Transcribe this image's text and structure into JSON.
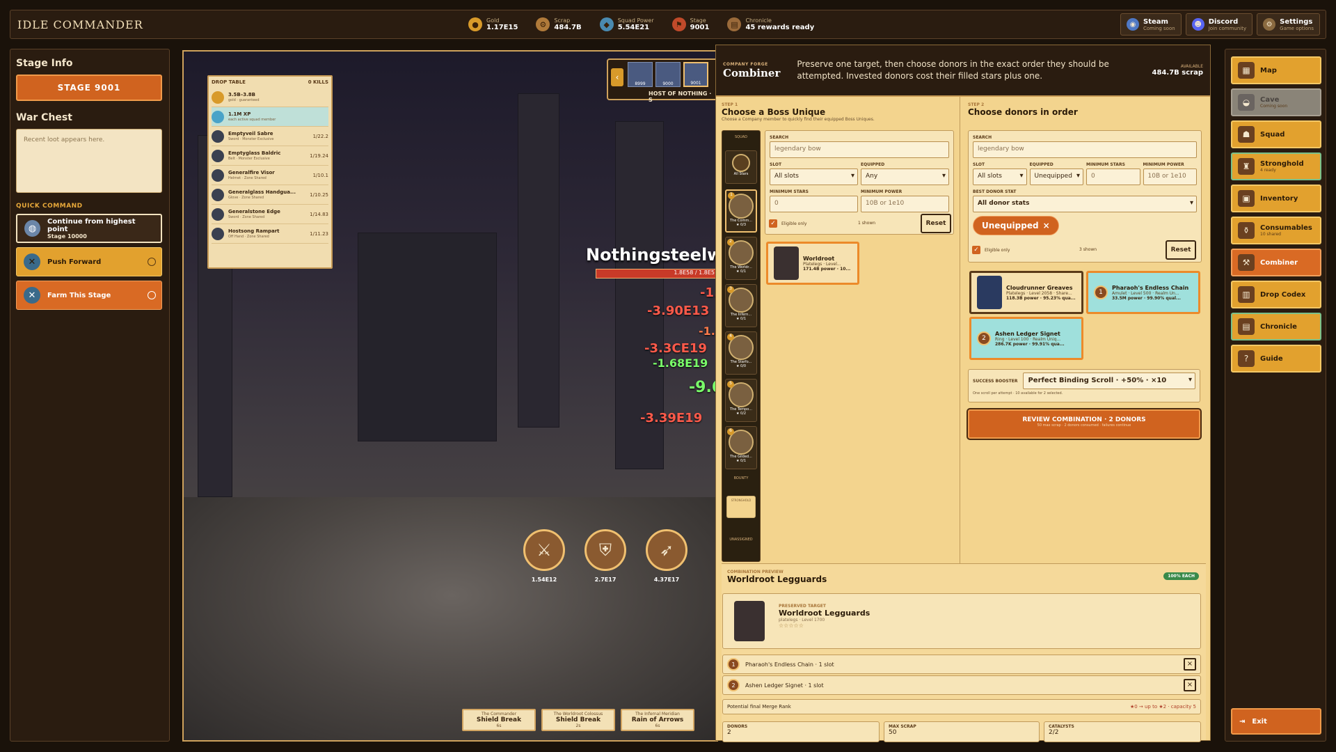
{
  "topbar": {
    "brand": "IDLE COMMANDER",
    "resources": [
      {
        "label": "Gold",
        "value": "1.17E15",
        "icon": "gold-coin-icon"
      },
      {
        "label": "Scrap",
        "value": "484.7B",
        "icon": "scrap-icon"
      },
      {
        "label": "Squad Power",
        "value": "5.54E21",
        "icon": "shield-icon"
      },
      {
        "label": "Stage",
        "value": "9001",
        "icon": "flag-icon"
      },
      {
        "label": "Chronicle",
        "value": "45 rewards ready",
        "icon": "book-icon"
      }
    ],
    "buttons": [
      {
        "title": "Steam",
        "sub": "Coming soon"
      },
      {
        "title": "Discord",
        "sub": "Join community"
      },
      {
        "title": "Settings",
        "sub": "Game options"
      }
    ]
  },
  "left": {
    "stage_info_title": "Stage Info",
    "stage_button": "STAGE 9001",
    "war_chest_title": "War Chest",
    "war_chest_placeholder": "Recent loot appears here.",
    "quick_command_title": "QUICK COMMAND",
    "continue_label": "Continue from highest point",
    "continue_sub": "Stage 10000",
    "push_label": "Push Forward",
    "farm_label": "Farm This Stage"
  },
  "drop_table": {
    "title": "DROP TABLE",
    "kills": "0 KILLS",
    "rows": [
      {
        "name": "3.5B–3.8B",
        "sub": "gold · guaranteed",
        "odds": ""
      },
      {
        "name": "1.1M XP",
        "sub": "each active squad member",
        "odds": ""
      },
      {
        "name": "Emptyveil Sabre",
        "sub": "Sword · Monster Exclusive",
        "odds": "1/22.2"
      },
      {
        "name": "Emptyglass Baldric",
        "sub": "Belt · Monster Exclusive",
        "odds": "1/19.24"
      },
      {
        "name": "Generalfire Visor",
        "sub": "Helmet · Zone Shared",
        "odds": "1/10.1"
      },
      {
        "name": "Generalglass Handgua...",
        "sub": "Glove · Zone Shared",
        "odds": "1/10.25"
      },
      {
        "name": "Generalstone Edge",
        "sub": "Sword · Zone Shared",
        "odds": "1/14.83"
      },
      {
        "name": "Hostsong Rampart",
        "sub": "Off Hand · Zone Shared",
        "odds": "1/11.23"
      }
    ]
  },
  "stage_picker": {
    "stages": [
      "8999",
      "9000",
      "9001"
    ],
    "label": "HOST OF NOTHING · S"
  },
  "battle": {
    "boss_name": "Nothingsteelw",
    "boss_hp": "1.8E58 / 1.8E5",
    "damage_numbers": [
      "-3.90E13",
      "-3.3CE19",
      "-1.68E19",
      "-9.6",
      "-3.39E19",
      "-1.5",
      "-1.1"
    ],
    "heroes": [
      "1.54E12",
      "2.7E17",
      "4.37E17"
    ],
    "skills": [
      {
        "owner": "The Commander",
        "name": "Shield Break",
        "count": "6s"
      },
      {
        "owner": "The Worldroot Colossus",
        "name": "Shield Break",
        "count": "2s"
      },
      {
        "owner": "The Infernal Meridian",
        "name": "Rain of Arrows",
        "count": "6s"
      }
    ]
  },
  "forge": {
    "tag": "COMPANY FORGE",
    "title": "Combiner",
    "desc": "Preserve one target, then choose donors in the exact order they should be attempted. Invested donors cost their filled stars plus one.",
    "available_label": "AVAILABLE",
    "available_value": "484.7B scrap",
    "step1": {
      "tag": "STEP 1",
      "title": "Choose a Boss Unique",
      "sub": "Choose a Company member to quickly find their equipped Boss Uniques.",
      "search_label": "SEARCH",
      "search_placeholder": "legendary bow",
      "slot_label": "SLOT",
      "slot_value": "All slots",
      "equipped_label": "EQUIPPED",
      "equipped_value": "Any",
      "min_stars_label": "MINIMUM STARS",
      "min_stars_placeholder": "0",
      "min_power_label": "MINIMUM POWER",
      "min_power_placeholder": "10B or 1e10",
      "eligible_label": "Eligible only",
      "shown": "1 shown",
      "reset": "Reset",
      "result": {
        "name": "Worldroot",
        "sub": "Platelegs · Level...",
        "power": "171.4B power · 10..."
      }
    },
    "squad": {
      "top_label": "SQUAD",
      "all_label": "All Stars",
      "members": [
        {
          "num": "1",
          "name": "The Comm...",
          "stars": "★ 0/3"
        },
        {
          "num": "2",
          "name": "The Worldr...",
          "stars": "★ 0/1"
        },
        {
          "num": "3",
          "name": "The Infern...",
          "stars": "★ 0/1"
        },
        {
          "num": "4",
          "name": "The Starfo...",
          "stars": "★ 0/0"
        },
        {
          "num": "5",
          "name": "The Tempo...",
          "stars": "★ 0/2"
        },
        {
          "num": "6",
          "name": "The Gilded...",
          "stars": "★ 0/1"
        }
      ],
      "bounty_label": "BOUNTY",
      "stronghold_label": "STRONGHOLD",
      "unassigned_label": "UNASSIGNED"
    },
    "step2": {
      "tag": "STEP 2",
      "title": "Choose donors in order",
      "search_label": "SEARCH",
      "search_placeholder": "legendary bow",
      "slot_label": "SLOT",
      "slot_value": "All slots",
      "equipped_label": "EQUIPPED",
      "equipped_value": "Unequipped",
      "min_stars_label": "MINIMUM STARS",
      "min_stars_placeholder": "0",
      "min_power_label": "MINIMUM POWER",
      "min_power_placeholder": "10B or 1e10",
      "best_stat_label": "BEST DONOR STAT",
      "best_stat_value": "All donor stats",
      "chip": "Unequipped",
      "eligible_label": "Eligible only",
      "shown": "3 shown",
      "reset": "Reset",
      "donors": [
        {
          "name": "Cloudrunner Greaves",
          "sub": "Platelegs · Level 2058 · Share...",
          "power": "118.3B power · 95.23% qua..."
        },
        {
          "name": "Pharaoh's Endless Chain",
          "sub": "Amulet · Level 500 · Realm Un...",
          "power": "33.5M power · 99.90% qual...",
          "badge": "1"
        },
        {
          "name": "Ashen Ledger Signet",
          "sub": "Ring · Level 100 · Realm Uniq...",
          "power": "286.7K power · 99.91% qua...",
          "badge": "2"
        }
      ],
      "booster_label": "SUCCESS BOOSTER",
      "booster_value": "Perfect Binding Scroll · +50% · ×10",
      "booster_note": "One scroll per attempt · 10 available for 2 selected.",
      "review_label": "REVIEW COMBINATION · 2 DONORS",
      "review_sub": "50 max scrap · 2 donors consumed · failures continue"
    },
    "preview": {
      "tag": "COMBINATION PREVIEW",
      "title": "Worldroot Legguards",
      "badge": "100% EACH",
      "preserved_tag": "PRESERVED TARGET",
      "target_name": "Worldroot Legguards",
      "target_sub": "platelegs · Level 1700",
      "target_stars": "☆☆☆☆☆",
      "donor_rows": [
        {
          "num": "1",
          "label": "Pharaoh's Endless Chain · 1 slot"
        },
        {
          "num": "2",
          "label": "Ashen Ledger Signet · 1 slot"
        }
      ],
      "rank_label": "Potential final Merge Rank",
      "rank_value": "★0 → up to ★2 · capacity 5",
      "stats": [
        {
          "label": "DONORS",
          "value": "2"
        },
        {
          "label": "MAX SCRAP",
          "value": "50"
        },
        {
          "label": "CATALYSTS",
          "value": "2/2"
        }
      ]
    }
  },
  "nav": {
    "items": [
      {
        "title": "Map",
        "sub": "",
        "state": "normal"
      },
      {
        "title": "Cave",
        "sub": "Coming soon",
        "state": "disabled"
      },
      {
        "title": "Squad",
        "sub": "",
        "state": "normal"
      },
      {
        "title": "Stronghold",
        "sub": "4 ready",
        "state": "green"
      },
      {
        "title": "Inventory",
        "sub": "",
        "state": "normal"
      },
      {
        "title": "Consumables",
        "sub": "10 shared",
        "state": "normal"
      },
      {
        "title": "Combiner",
        "sub": "",
        "state": "active"
      },
      {
        "title": "Drop Codex",
        "sub": "",
        "state": "normal"
      },
      {
        "title": "Chronicle",
        "sub": "",
        "state": "green"
      },
      {
        "title": "Guide",
        "sub": "",
        "state": "normal"
      }
    ],
    "exit": "Exit"
  }
}
